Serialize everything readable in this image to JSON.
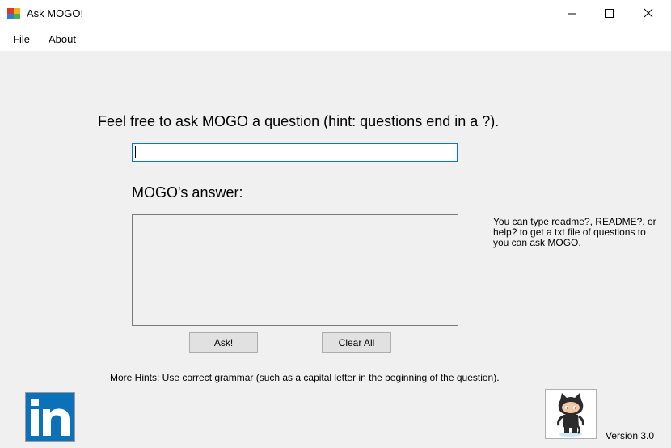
{
  "window": {
    "title": "Ask MOGO!",
    "icon": "app-window-icon",
    "controls": [
      "minimize-icon",
      "maximize-icon",
      "close-icon"
    ]
  },
  "menu": {
    "file": "File",
    "about": "About"
  },
  "form": {
    "prompt": "Feel free to ask MOGO a question (hint: questions end in a ?).",
    "question_value": "",
    "answer_label": "MOGO's answer:",
    "answer_value": "",
    "side_hint": "You can type readme?, README?, or help? to get a txt file of questions to you can ask MOGO.",
    "ask_button": "Ask!",
    "clear_button": "Clear All",
    "more_hints": "More Hints: Use correct grammar (such as a capital letter in the beginning of the question).",
    "version": "Version 3.0"
  },
  "logos": {
    "linkedin_text": "in",
    "github": "octocat-icon"
  },
  "colors": {
    "background": "#f0f0f0",
    "input_focus_border": "#0078d7",
    "linkedin_blue": "#0b71b9"
  }
}
